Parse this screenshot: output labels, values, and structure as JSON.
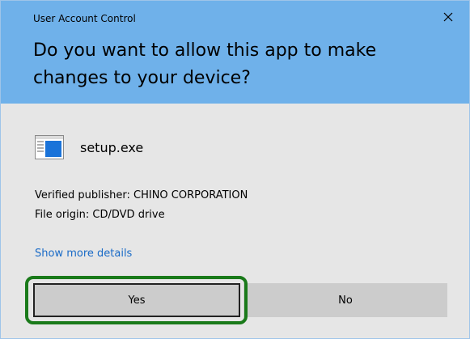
{
  "window": {
    "title": "User Account Control",
    "close_icon": "close-icon"
  },
  "header": {
    "question": "Do you want to allow this app to make changes to your device?"
  },
  "app": {
    "icon": "application-window-icon",
    "name": "setup.exe"
  },
  "info": {
    "publisher": "Verified publisher: CHINO CORPORATION",
    "origin": "File origin: CD/DVD drive"
  },
  "links": {
    "show_more": "Show more details"
  },
  "buttons": {
    "yes": "Yes",
    "no": "No"
  },
  "colors": {
    "header_bg": "#6fb1ea",
    "body_bg": "#e6e6e6",
    "button_bg": "#cccccc",
    "link": "#1a6bc7",
    "highlight": "#1a7a1a"
  }
}
